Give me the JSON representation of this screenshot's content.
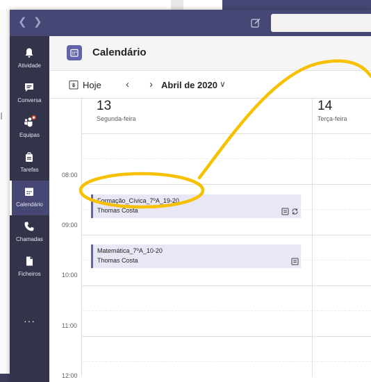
{
  "rail": {
    "items": [
      {
        "label": "Atividade",
        "icon": "bell-icon"
      },
      {
        "label": "Conversa",
        "icon": "chat-icon"
      },
      {
        "label": "Equipas",
        "icon": "teams-icon"
      },
      {
        "label": "Tarefas",
        "icon": "assignments-icon"
      },
      {
        "label": "Calendário",
        "icon": "calendar-icon"
      },
      {
        "label": "Chamadas",
        "icon": "phone-icon"
      },
      {
        "label": "Ficheiros",
        "icon": "file-icon"
      }
    ],
    "more": "···"
  },
  "header": {
    "title": "Calendário"
  },
  "toolbar": {
    "today": "Hoje",
    "month": "Abril de 2020",
    "prev": "‹",
    "next": "›",
    "chevron": "∨"
  },
  "days": [
    {
      "num": "13",
      "name": "Segunda-feira"
    },
    {
      "num": "14",
      "name": "Terça-feira"
    }
  ],
  "times": [
    "08:00",
    "09:00",
    "10:00",
    "11:00",
    "12:00"
  ],
  "events": [
    {
      "title": "Formação_Cívica_7ºA_19-20",
      "organizer": "Thomas Costa"
    },
    {
      "title": "Matemática_7ºA_10-20",
      "organizer": "Thomas Costa"
    }
  ],
  "background": {
    "left_text": "I"
  },
  "colors": {
    "accent": "#6264a7",
    "titlebar": "#464775",
    "rail": "#33344a",
    "annotation": "#f7c000",
    "event_bg": "#e8e7f5"
  }
}
